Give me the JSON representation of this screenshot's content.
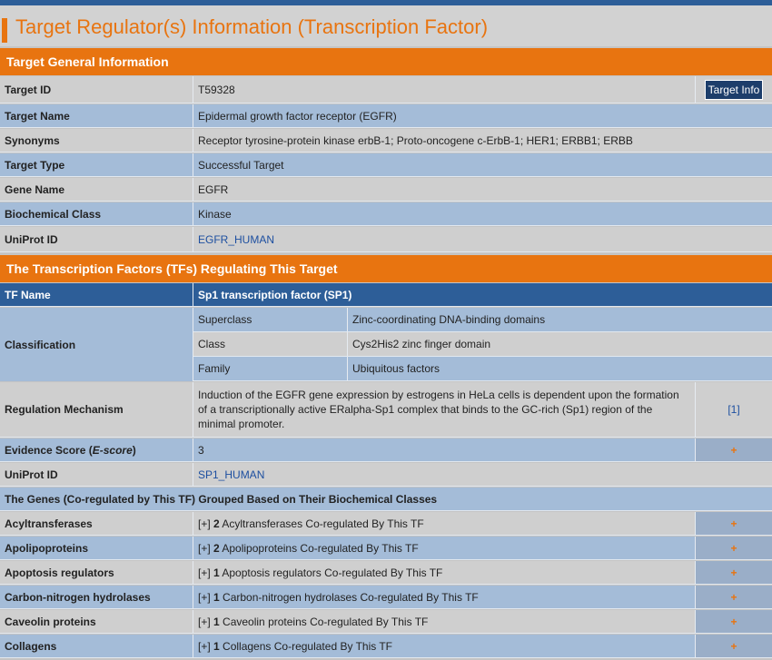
{
  "page_title": "Target Regulator(s) Information (Transcription Factor)",
  "general": {
    "heading": "Target General Information",
    "target_id_label": "Target ID",
    "target_id": "T59328",
    "target_info_button": "Target Info",
    "target_name_label": "Target Name",
    "target_name": "Epidermal growth factor receptor (EGFR)",
    "synonyms_label": "Synonyms",
    "synonyms": "Receptor tyrosine-protein kinase erbB-1; Proto-oncogene c-ErbB-1; HER1; ERBB1; ERBB",
    "target_type_label": "Target Type",
    "target_type": "Successful Target",
    "gene_name_label": "Gene Name",
    "gene_name": "EGFR",
    "biochemical_class_label": "Biochemical Class",
    "biochemical_class": "Kinase",
    "uniprot_label": "UniProt ID",
    "uniprot": "EGFR_HUMAN"
  },
  "tf": {
    "heading": "The Transcription Factors (TFs) Regulating This Target",
    "tf_name_label": "TF Name",
    "tf_name": "Sp1 transcription factor (SP1)",
    "classification_label": "Classification",
    "superclass_label": "Superclass",
    "superclass": "Zinc-coordinating DNA-binding domains",
    "class_label": "Class",
    "class": "Cys2His2 zinc finger domain",
    "family_label": "Family",
    "family": "Ubiquitous factors",
    "mechanism_label": "Regulation Mechanism",
    "mechanism": "Induction of the EGFR gene expression by estrogens in HeLa cells is dependent upon the formation of a transcriptionally active ERalpha-Sp1 complex that binds to the GC-rich (Sp1) region of the minimal promoter.",
    "mechanism_ref": "[1]",
    "evidence_label_pre": "Evidence Score (",
    "evidence_label_em": "E-score",
    "evidence_label_post": ")",
    "evidence_score": "3",
    "uniprot_label": "UniProt ID",
    "uniprot": "SP1_HUMAN",
    "genes_heading": "The Genes (Co-regulated by This TF) Grouped Based on Their Biochemical Classes"
  },
  "gene_groups": [
    {
      "name": "Acyltransferases",
      "prefix": "[+] ",
      "count": "2",
      "text": " Acyltransferases Co-regulated By This TF",
      "toggle": "+"
    },
    {
      "name": "Apolipoproteins",
      "prefix": "[+] ",
      "count": "2",
      "text": " Apolipoproteins Co-regulated By This TF",
      "toggle": "+"
    },
    {
      "name": "Apoptosis regulators",
      "prefix": "[+] ",
      "count": "1",
      "text": " Apoptosis regulators Co-regulated By This TF",
      "toggle": "+"
    },
    {
      "name": "Carbon-nitrogen hydrolases",
      "prefix": "[+] ",
      "count": "1",
      "text": " Carbon-nitrogen hydrolases Co-regulated By This TF",
      "toggle": "+"
    },
    {
      "name": "Caveolin proteins",
      "prefix": "[+] ",
      "count": "1",
      "text": " Caveolin proteins Co-regulated By This TF",
      "toggle": "+"
    },
    {
      "name": "Collagens",
      "prefix": "[+] ",
      "count": "1",
      "text": " Collagens Co-regulated By This TF",
      "toggle": "+"
    }
  ],
  "evidence_toggle": "+",
  "colors": {
    "accent": "#e87410",
    "header_blue": "#2d5e98",
    "row_blue": "#a4bcd8",
    "row_gray": "#cfcfcf"
  }
}
